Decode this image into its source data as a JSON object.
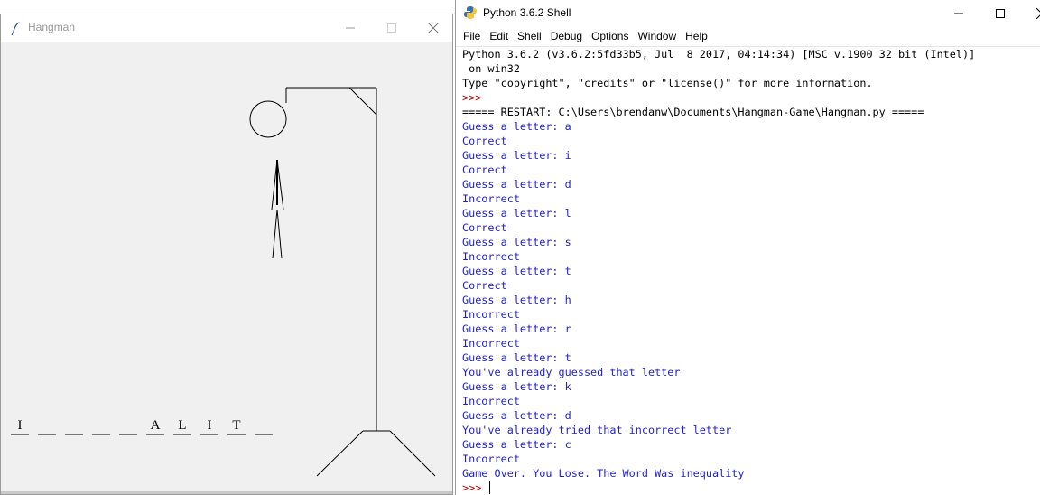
{
  "hangman_window": {
    "title": "Hangman",
    "word_slots": [
      "I",
      "",
      "",
      "",
      "",
      "A",
      "L",
      "I",
      "T",
      ""
    ]
  },
  "shell_window": {
    "title": "Python 3.6.2 Shell",
    "menu": [
      "File",
      "Edit",
      "Shell",
      "Debug",
      "Options",
      "Window",
      "Help"
    ],
    "lines": [
      {
        "text": "Python 3.6.2 (v3.6.2:5fd33b5, Jul  8 2017, 04:14:34) [MSC v.1900 32 bit (Intel)]",
        "color": "black"
      },
      {
        "text": " on win32",
        "color": "black"
      },
      {
        "text": "Type \"copyright\", \"credits\" or \"license()\" for more information.",
        "color": "black"
      },
      {
        "text": ">>> ",
        "color": "red"
      },
      {
        "text": "===== RESTART: C:\\Users\\brendanw\\Documents\\Hangman-Game\\Hangman.py =====",
        "color": "black"
      },
      {
        "text": "Guess a letter: a",
        "color": "blue"
      },
      {
        "text": "Correct",
        "color": "blue"
      },
      {
        "text": "Guess a letter: i",
        "color": "blue"
      },
      {
        "text": "Correct",
        "color": "blue"
      },
      {
        "text": "Guess a letter: d",
        "color": "blue"
      },
      {
        "text": "Incorrect",
        "color": "blue"
      },
      {
        "text": "Guess a letter: l",
        "color": "blue"
      },
      {
        "text": "Correct",
        "color": "blue"
      },
      {
        "text": "Guess a letter: s",
        "color": "blue"
      },
      {
        "text": "Incorrect",
        "color": "blue"
      },
      {
        "text": "Guess a letter: t",
        "color": "blue"
      },
      {
        "text": "Correct",
        "color": "blue"
      },
      {
        "text": "Guess a letter: h",
        "color": "blue"
      },
      {
        "text": "Incorrect",
        "color": "blue"
      },
      {
        "text": "Guess a letter: r",
        "color": "blue"
      },
      {
        "text": "Incorrect",
        "color": "blue"
      },
      {
        "text": "Guess a letter: t",
        "color": "blue"
      },
      {
        "text": "You've already guessed that letter",
        "color": "blue"
      },
      {
        "text": "Guess a letter: k",
        "color": "blue"
      },
      {
        "text": "Incorrect",
        "color": "blue"
      },
      {
        "text": "Guess a letter: d",
        "color": "blue"
      },
      {
        "text": "You've already tried that incorrect letter",
        "color": "blue"
      },
      {
        "text": "Guess a letter: c",
        "color": "blue"
      },
      {
        "text": "Incorrect",
        "color": "blue"
      },
      {
        "text": "Game Over. You Lose. The Word Was inequality",
        "color": "blue"
      }
    ],
    "prompt": ">>> "
  },
  "colors": {
    "output_blue": "#1f1fd0",
    "prompt_red": "#c00000",
    "canvas_bg": "#f0f0f0"
  },
  "icons": {
    "hangman_window": "feather-icon",
    "shell_window": "python-icon",
    "window_controls": [
      "minimize-icon",
      "maximize-icon",
      "close-icon"
    ]
  }
}
